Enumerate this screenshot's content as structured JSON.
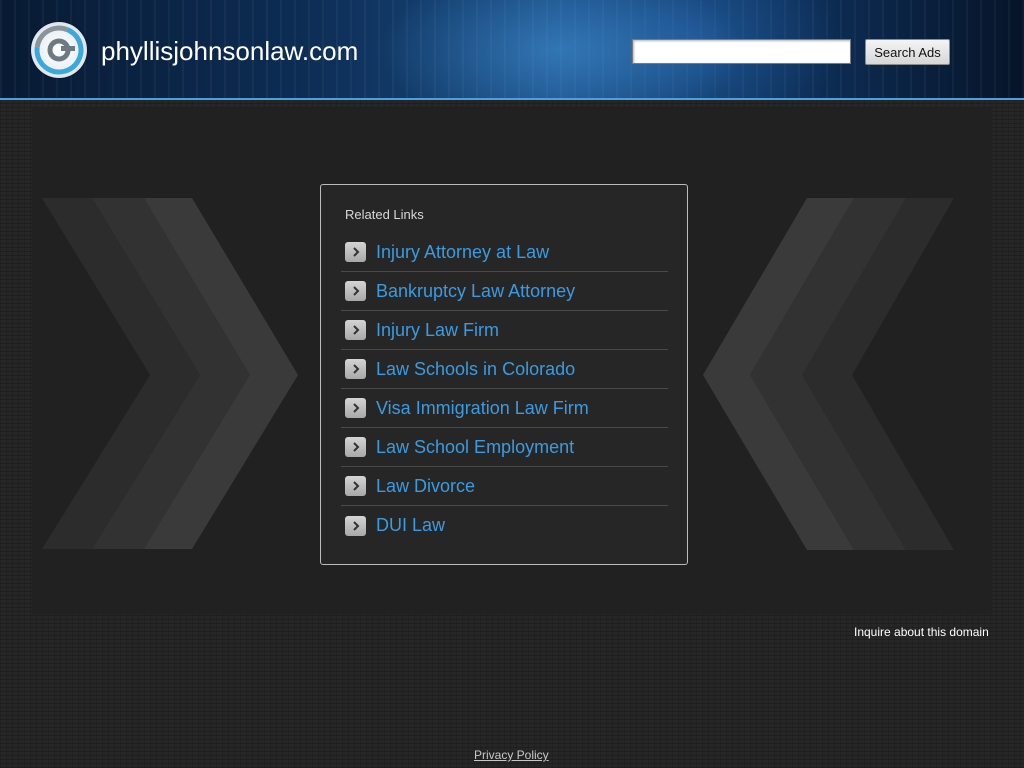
{
  "header": {
    "site_title": "phyllisjohnsonlaw.com",
    "search": {
      "value": "",
      "placeholder": ""
    },
    "search_button_label": "Search Ads"
  },
  "related_links": {
    "title": "Related Links",
    "items": [
      {
        "label": "Injury Attorney at Law"
      },
      {
        "label": "Bankruptcy Law Attorney"
      },
      {
        "label": "Injury Law Firm"
      },
      {
        "label": "Law Schools in Colorado"
      },
      {
        "label": "Visa Immigration Law Firm"
      },
      {
        "label": "Law School Employment"
      },
      {
        "label": "Law Divorce"
      },
      {
        "label": "DUI Law"
      }
    ]
  },
  "footer": {
    "inquire_label": "Inquire about this domain",
    "privacy_label": "Privacy Policy"
  },
  "colors": {
    "link": "#3b9be0",
    "header_accent": "#4aa0e0",
    "background": "#262626"
  },
  "icons": {
    "logo": "at-sign-logo-icon",
    "link_arrow": "chevron-right-icon"
  }
}
